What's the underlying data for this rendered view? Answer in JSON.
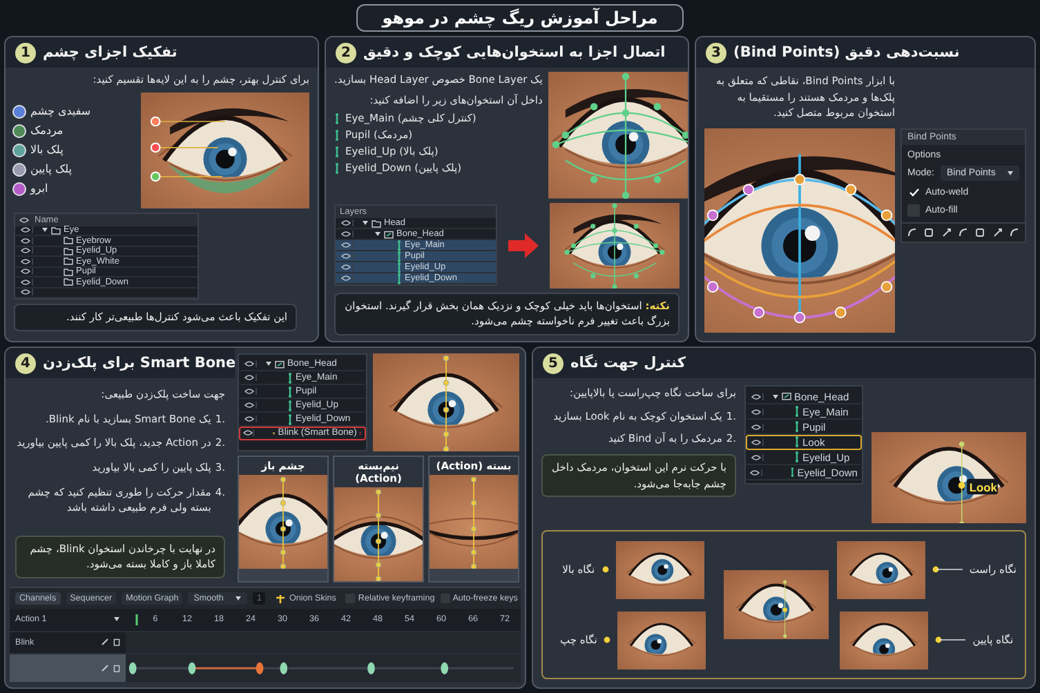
{
  "title": "مراحل آموزش ریگ چشم در موهو",
  "step_1": {
    "number": "1",
    "title": "تفکیک اجزای چشم",
    "intro": "برای کنترل بهتر، چشم را به این لایه‌ها تقسیم کنید:",
    "parts": [
      {
        "label": "سفیدی چشم",
        "color": "#5a7fd8"
      },
      {
        "label": "مردمک",
        "color": "#4f8a57"
      },
      {
        "label": "پلک بالا",
        "color": "#5fa39c"
      },
      {
        "label": "پلک پایین",
        "color": "#9b9bb0"
      },
      {
        "label": "ابرو",
        "color": "#b45cc8"
      }
    ],
    "layers": {
      "column": "Name",
      "rows": [
        {
          "name": "Eye",
          "kind": "folder",
          "expanded": true,
          "selected": false,
          "children": [
            {
              "name": "Eyebrow",
              "kind": "folder",
              "selected": false
            },
            {
              "name": "Eyelid_Up",
              "kind": "folder",
              "selected": false
            },
            {
              "name": "Eye_White",
              "kind": "folder",
              "selected": false
            },
            {
              "name": "Pupil",
              "kind": "folder",
              "selected": false
            },
            {
              "name": "Eyelid_Down",
              "kind": "folder",
              "selected": false
            }
          ]
        }
      ]
    },
    "note": "این تفکیک باعث می‌شود کنترل‌ها طبیعی‌تر کار کنند."
  },
  "step_2": {
    "number": "2",
    "title": "اتصال اجزا به استخوان‌هایی کوچک و دقیق",
    "intro": [
      "یک Bone Layer خصوص Head Layer بسازید.",
      "داخل آن استخوان‌های زیر را اضافه کنید:"
    ],
    "bones": [
      "Eye_Main (کنترل کلی چشم)",
      "Pupil (مردمک)",
      "Eyelid_Up (پلک بالا)",
      "Eyelid_Down (پلک پایین)"
    ],
    "layers": {
      "title": "Layers",
      "rows": [
        {
          "name": "Head",
          "kind": "folder",
          "expanded": true,
          "selected": false,
          "children": [
            {
              "name": "Bone_Head",
              "kind": "bone_layer",
              "expanded": true,
              "selected": false,
              "children": [
                {
                  "name": "Eye_Main",
                  "kind": "bone",
                  "selected": true
                },
                {
                  "name": "Pupil",
                  "kind": "bone",
                  "selected": true
                },
                {
                  "name": "Eyelid_Up",
                  "kind": "bone",
                  "selected": true
                },
                {
                  "name": "Eyelid_Down",
                  "kind": "bone",
                  "selected": true
                }
              ]
            }
          ]
        }
      ]
    },
    "note": "**نکته:** استخوان‌ها باید خیلی کوچک و نزدیک همان بخش قرار گیرند. استخوان بزرگ باعث تغییر فرم ناخواسته چشم می‌شود."
  },
  "step_3": {
    "number": "3",
    "title": "نسبت‌دهی دقیق (Bind Points)",
    "text": "با ابزار Bind Points، نقاطی که متعلق به پلک‌ها و مردمک هستند را مستقیما به استخوان مربوط متصل کنید.",
    "tool": {
      "title": "Bind Points",
      "section": "Options",
      "mode_label": "Mode:",
      "mode": "Bind Points",
      "options": [
        {
          "label": "Auto-weld",
          "checked": true
        },
        {
          "label": "Auto-fill",
          "checked": false
        }
      ]
    }
  },
  "step_4": {
    "number": "4",
    "title": "Smart Bone برای پلک‌زدن",
    "intro": "جهت ساخت پلک‌زدن طبیعی:",
    "steps": [
      {
        "number": "1.",
        "text": "یک Smart Bone بسازید با نام Blink."
      },
      {
        "number": "2.",
        "text": "در Action جدید، پلک بالا را کمی پایین بیاورید"
      },
      {
        "number": "3.",
        "text": "پلک پایین را کمی بالا بیاورید"
      },
      {
        "number": "4.",
        "text": "مقدار حرکت را طوری تنظیم کنید که چشم بسته ولی فرم طبیعی داشته باشد"
      }
    ],
    "note": "در نهایت با چرخاندن استخوان Blink، چشم کاملا باز و کاملا بسته می‌شود.",
    "layers": {
      "rows": [
        {
          "name": "Bone_Head",
          "kind": "bone_layer",
          "expanded": true,
          "selected": false,
          "children": [
            {
              "name": "Eye_Main",
              "kind": "bone",
              "selected": false
            },
            {
              "name": "Pupil",
              "kind": "bone",
              "selected": false
            },
            {
              "name": "Eyelid_Up",
              "kind": "bone",
              "selected": false
            },
            {
              "name": "Eyelid_Down",
              "kind": "bone",
              "selected": false
            },
            {
              "name": "Blink (Smart Bone)",
              "kind": "smart_bone",
              "selected": true
            }
          ]
        }
      ]
    },
    "frames": [
      {
        "label": "بسته (Action)",
        "kind": "closed"
      },
      {
        "label": "نیم‌بسته (Action)",
        "kind": "half"
      },
      {
        "label": "چشم باز",
        "kind": "open"
      }
    ],
    "timeline": {
      "toolbar": [
        {
          "kind": "checkbox",
          "label": "Auto-freeze keys",
          "checked": false
        },
        {
          "kind": "checkbox",
          "label": "Relative keyframing",
          "checked": false
        },
        {
          "kind": "button",
          "label": "Onion Skins"
        },
        {
          "kind": "field",
          "label": "1"
        },
        {
          "kind": "dropdown",
          "label": "Smooth"
        },
        {
          "kind": "tab",
          "label": "Motion Graph",
          "selected": false
        },
        {
          "kind": "tab",
          "label": "Sequencer",
          "selected": false
        },
        {
          "kind": "tab",
          "label": "Channels",
          "selected": true
        }
      ],
      "action": "Action 1",
      "ruler": [
        "72",
        "66",
        "60",
        "54",
        "48",
        "42",
        "36",
        "30",
        "24",
        "18",
        "12",
        "6"
      ],
      "tracks": [
        {
          "name": "Blink",
          "selected": false
        },
        {
          "selected": true
        }
      ]
    }
  },
  "step_5": {
    "number": "5",
    "title": "کنترل جهت نگاه",
    "intro": "برای ساخت نگاه چپ‌راست یا بالاپایین:",
    "steps": [
      {
        "number": "1.",
        "text": "یک استخوان کوچک به نام Look بسازید"
      },
      {
        "number": "2.",
        "text": "مردمک را به آن Bind کنید"
      }
    ],
    "note": "با حرکت نرم این استخوان، مردمک داخل چشم جابه‌جا می‌شود.",
    "layers": {
      "rows": [
        {
          "name": "Bone_Head",
          "kind": "bone_layer",
          "expanded": true,
          "selected": false,
          "children": [
            {
              "name": "Eye_Main",
              "kind": "bone",
              "selected": false
            },
            {
              "name": "Pupil",
              "kind": "bone",
              "selected": false
            },
            {
              "name": "Look",
              "kind": "bone",
              "selected": true
            },
            {
              "name": "Eyelid_Up",
              "kind": "bone",
              "selected": false
            },
            {
              "name": "Eyelid_Down",
              "kind": "bone",
              "selected": false
            }
          ]
        }
      ]
    },
    "bone_label": "Look",
    "gaze": [
      {
        "label": "نگاه راست",
        "kind": "right"
      },
      {
        "label": "نگاه بالا",
        "kind": "up"
      },
      {
        "label": "نگاه پایین",
        "kind": "down"
      },
      {
        "label": "نگاه چپ",
        "kind": "left"
      }
    ]
  }
}
